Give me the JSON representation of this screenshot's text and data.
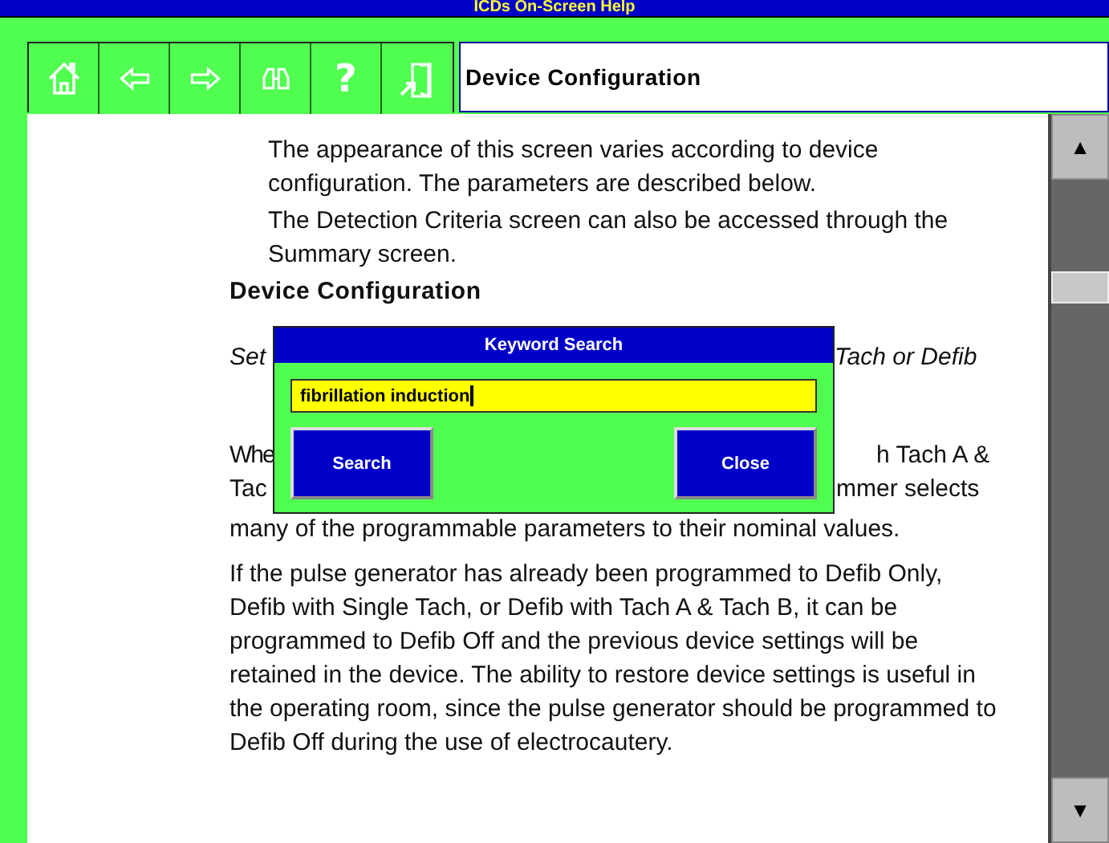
{
  "window": {
    "title": "ICDs On-Screen Help"
  },
  "toolbar": [
    {
      "kind": "home"
    },
    {
      "kind": "back"
    },
    {
      "kind": "forward"
    },
    {
      "kind": "search"
    },
    {
      "kind": "help",
      "label": "?"
    },
    {
      "kind": "exit"
    }
  ],
  "topic_title": "Device Configuration",
  "content": {
    "intro": [
      "The appearance of this screen varies according to device configuration. The parameters are described below.",
      "The Detection Criteria screen can also be accessed through the Summary screen."
    ],
    "heading": "Device Configuration",
    "partial_lines": [
      {
        "kind": "italic",
        "left": "Set",
        "right": "Tach or Defib"
      },
      {
        "kind": "plain",
        "left": "Whe",
        "right": "h Tach A &"
      },
      {
        "kind": "plain2",
        "left": "Tac",
        "right": "mmer selects"
      }
    ],
    "line_after": "many of the programmable parameters to their nominal values.",
    "paragraph": "If the pulse generator has already been programmed to Defib Only, Defib with Single Tach, or Defib with Tach A & Tach B, it can be programmed to Defib Off and the previous device settings will be retained in the device. The ability to restore device settings is useful in the operating room, since the pulse generator should be programmed to Defib Off during the use of electrocautery."
  },
  "dialog": {
    "title": "Keyword Search",
    "value": "fibrillation induction",
    "buttons": [
      "Search",
      "Close"
    ]
  },
  "scrollbar": {
    "up": "▲",
    "down": "▼"
  }
}
